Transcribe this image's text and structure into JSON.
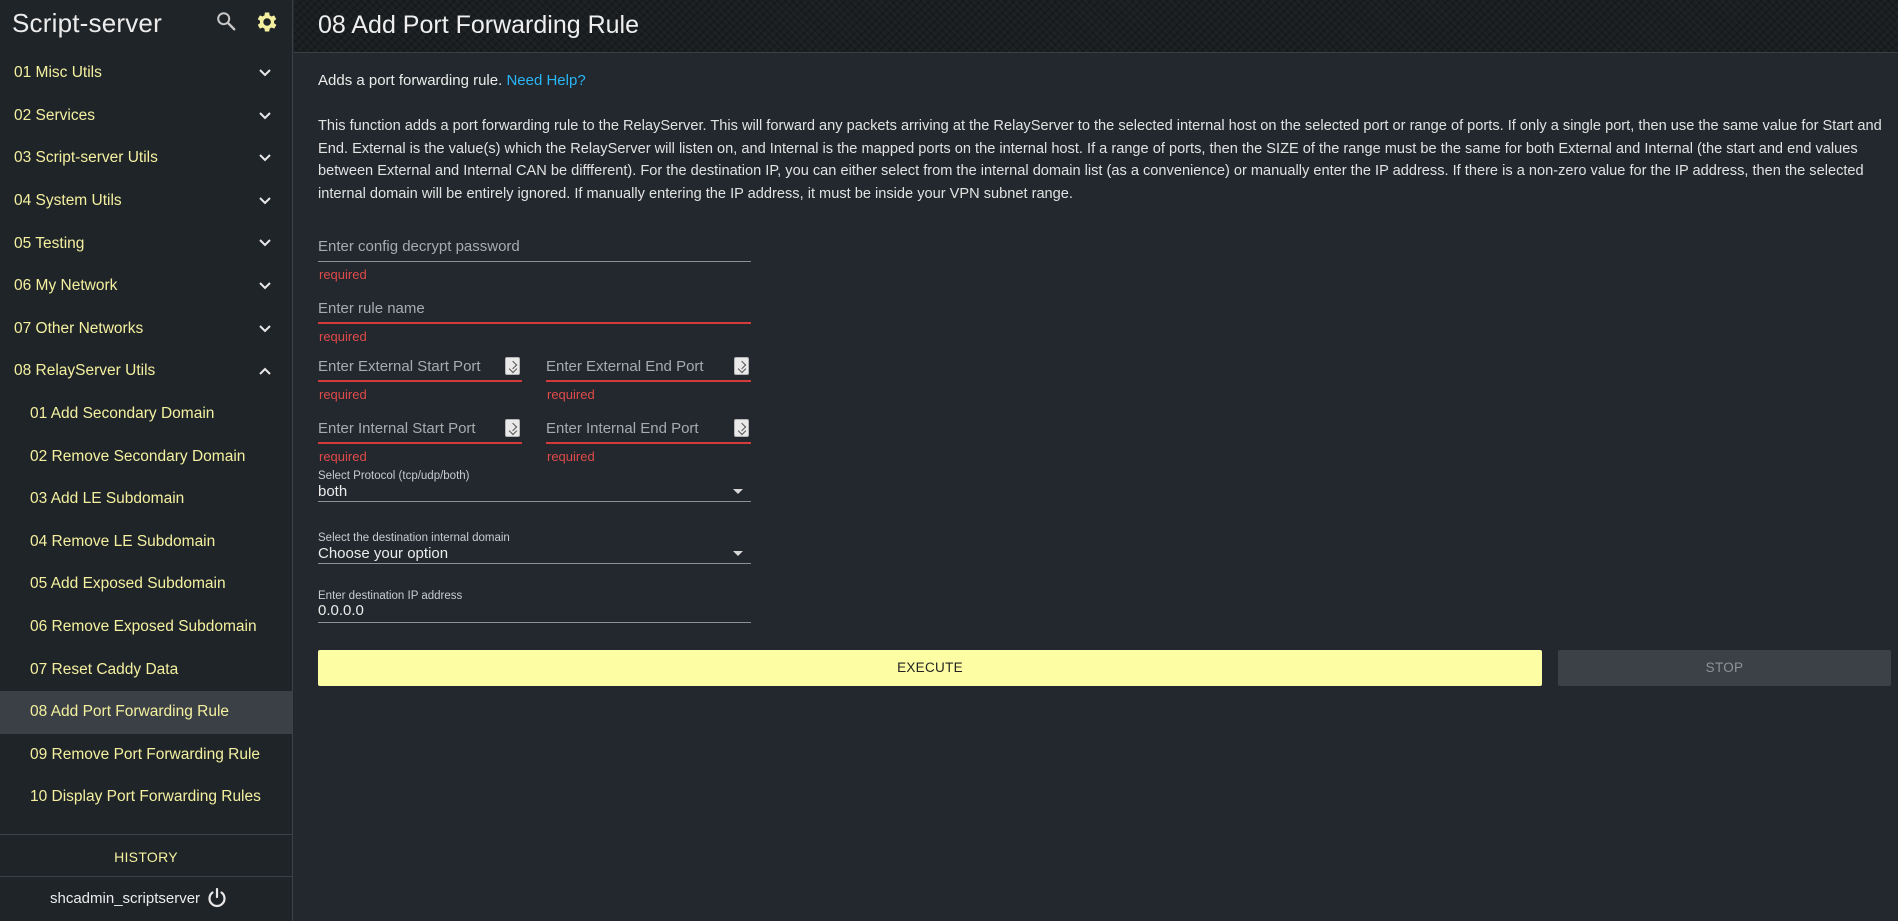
{
  "app": {
    "title": "Script-server",
    "icons": {
      "search": "search-icon",
      "settings": "gear-icon",
      "logout": "power-icon"
    },
    "colors": {
      "accent": "#f4f0a0",
      "error": "#e04a4a",
      "link": "#29b6f6",
      "execute_bg": "#fdfda3"
    }
  },
  "sidebar": {
    "groups": [
      {
        "label": "01 Misc Utils",
        "expanded": false
      },
      {
        "label": "02 Services",
        "expanded": false
      },
      {
        "label": "03 Script-server Utils",
        "expanded": false
      },
      {
        "label": "04 System Utils",
        "expanded": false
      },
      {
        "label": "05 Testing",
        "expanded": false
      },
      {
        "label": "06 My Network",
        "expanded": false
      },
      {
        "label": "07 Other Networks",
        "expanded": false
      },
      {
        "label": "08 RelayServer Utils",
        "expanded": true
      }
    ],
    "subitems": [
      "01 Add Secondary Domain",
      "02 Remove Secondary Domain",
      "03 Add LE Subdomain",
      "04 Remove LE Subdomain",
      "05 Add Exposed Subdomain",
      "06 Remove Exposed Subdomain",
      "07 Reset Caddy Data",
      "08 Add Port Forwarding Rule",
      "09 Remove Port Forwarding Rule",
      "10 Display Port Forwarding Rules"
    ],
    "active_subitem": "08 Add Port Forwarding Rule",
    "history_label": "HISTORY",
    "username": "shcadmin_scriptserver"
  },
  "main": {
    "title": "08 Add Port Forwarding Rule",
    "intro": "Adds a port forwarding rule.",
    "help_link": "Need Help?",
    "description": "This function adds a port forwarding rule to the RelayServer. This will forward any packets arriving at the RelayServer to the selected internal host on the selected port or range of ports. If only a single port, then use the same value for Start and End. External is the value(s) which the RelayServer will listen on, and Internal is the mapped ports on the internal host. If a range of ports, then the SIZE of the range must be the same for both External and Internal (the start and end values between External and Internal CAN be diffferent). For the destination IP, you can either select from the internal domain list (as a convenience) or manually enter the IP address. If there is a non-zero value for the IP address, then the selected internal domain will be entirely ignored. If manually entering the IP address, it must be inside your VPN subnet range.",
    "fields": {
      "password": {
        "placeholder": "Enter config decrypt password",
        "error": "required"
      },
      "rule_name": {
        "placeholder": "Enter rule name",
        "error": "required"
      },
      "ext_start": {
        "placeholder": "Enter External Start Port",
        "error": "required"
      },
      "ext_end": {
        "placeholder": "Enter External End Port",
        "error": "required"
      },
      "int_start": {
        "placeholder": "Enter Internal Start Port",
        "error": "required"
      },
      "int_end": {
        "placeholder": "Enter Internal End Port",
        "error": "required"
      },
      "protocol": {
        "label": "Select Protocol (tcp/udp/both)",
        "value": "both"
      },
      "domain": {
        "label": "Select the destination internal domain",
        "value": "Choose your option"
      },
      "ip": {
        "label": "Enter destination IP address",
        "value": "0.0.0.0"
      }
    },
    "buttons": {
      "execute": "EXECUTE",
      "stop": "STOP"
    }
  }
}
